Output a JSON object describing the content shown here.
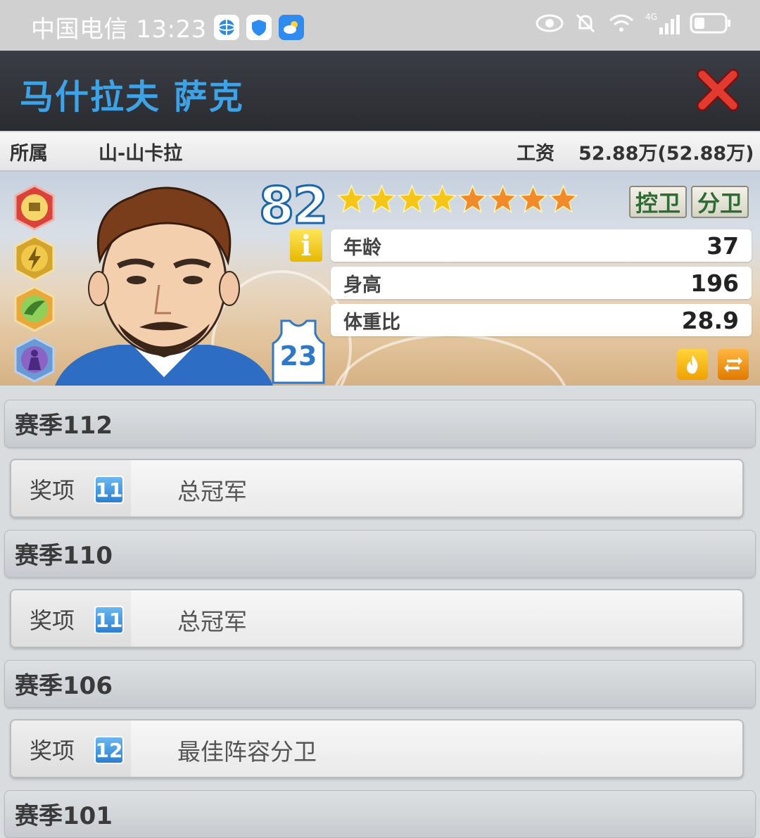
{
  "status_bar": {
    "carrier_time": "中国电信 13:23",
    "icons": [
      "browser-app-icon",
      "shield-app-icon",
      "weather-app-icon",
      "eye-icon",
      "bell-muted-icon",
      "wifi-icon",
      "signal-4g-icon",
      "battery-icon"
    ],
    "network_label": "4G"
  },
  "header": {
    "title": "马什拉夫 萨克",
    "close_icon": "close-icon"
  },
  "info": {
    "team_label": "所属",
    "team_value": "山-山卡拉",
    "salary_label": "工资",
    "salary_value": "52.88万(52.88万)"
  },
  "player": {
    "rating": "82",
    "stars_total": 8,
    "stars_gold": 4,
    "positions": [
      "控卫",
      "分卫"
    ],
    "jersey_number": "23",
    "info_icon": "i",
    "stats": [
      {
        "label": "年龄",
        "value": "37"
      },
      {
        "label": "身高",
        "value": "196"
      },
      {
        "label": "体重比",
        "value": "28.9"
      }
    ],
    "skill_badges": [
      "trophy-badge-icon",
      "lightning-badge-icon",
      "wing-badge-icon",
      "player-silhouette-badge-icon"
    ],
    "action_icons": [
      "fire-icon",
      "swap-icon"
    ]
  },
  "colors": {
    "title_blue": "#3ea3e6",
    "gold_star": "#f5c518",
    "orange_star": "#f08a2a",
    "position_green": "#2e6b35"
  },
  "seasons": [
    {
      "season": "赛季112",
      "award_label": "奖项",
      "award_count": "11",
      "award_name": "总冠军"
    },
    {
      "season": "赛季110",
      "award_label": "奖项",
      "award_count": "11",
      "award_name": "总冠军"
    },
    {
      "season": "赛季106",
      "award_label": "奖项",
      "award_count": "12",
      "award_name": "最佳阵容分卫"
    },
    {
      "season": "赛季101"
    }
  ]
}
